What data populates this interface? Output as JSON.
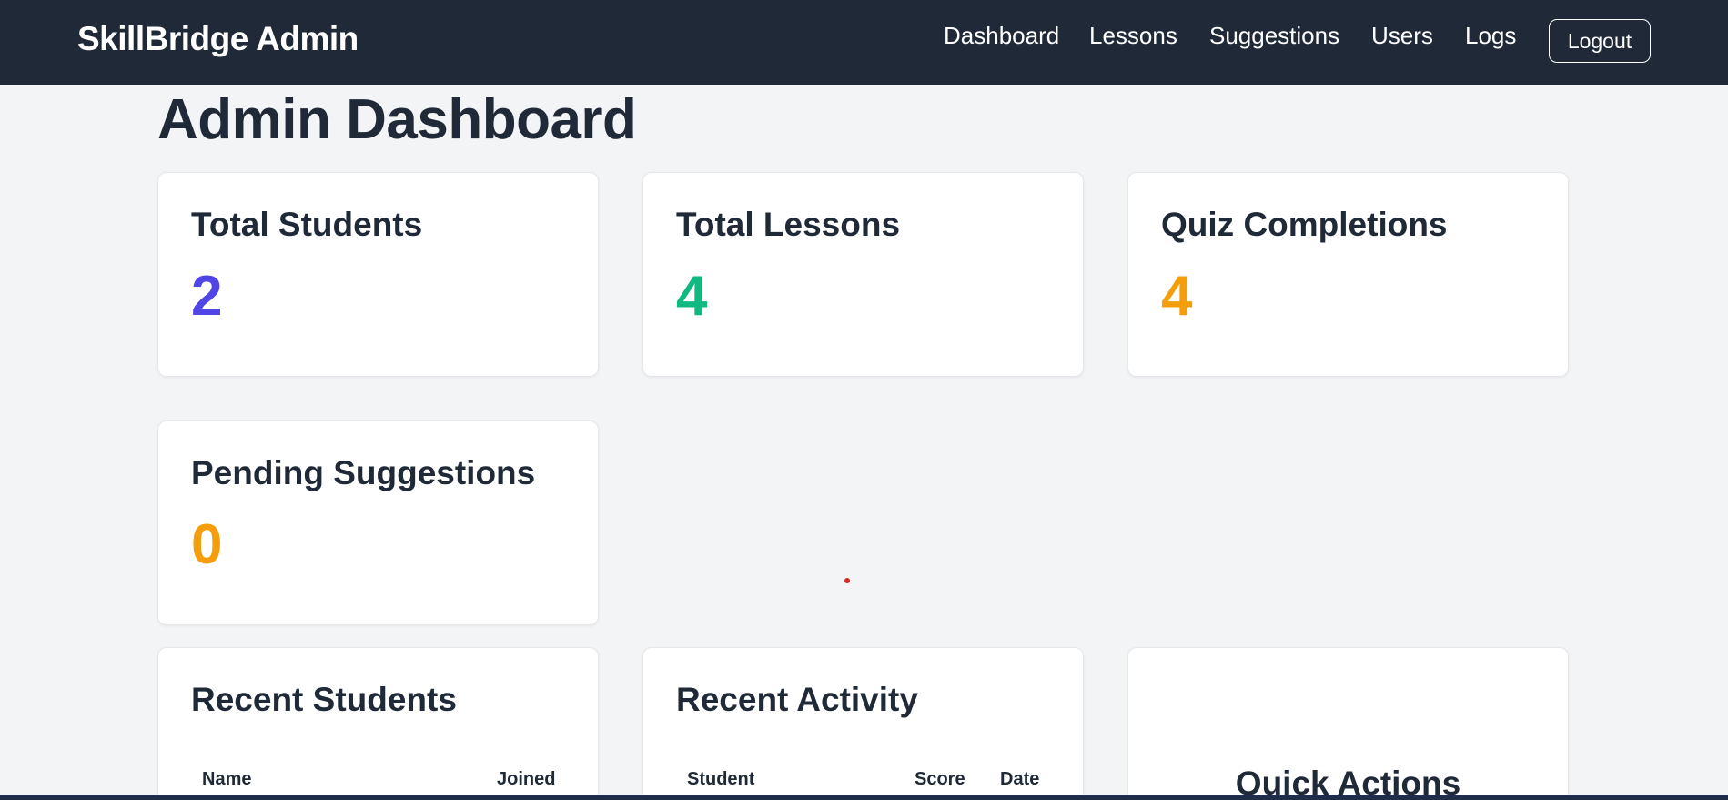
{
  "header": {
    "brand": "SkillBridge Admin",
    "nav": [
      "Dashboard",
      "Lessons",
      "Suggestions",
      "Users",
      "Logs"
    ],
    "logout_label": "Logout"
  },
  "main": {
    "title": "Admin Dashboard",
    "stats": [
      {
        "label": "Total Students",
        "value": "2",
        "color": "#4f46e5"
      },
      {
        "label": "Total Lessons",
        "value": "4",
        "color": "#10b981"
      },
      {
        "label": "Quiz Completions",
        "value": "4",
        "color": "#f59e0b"
      },
      {
        "label": "Pending Suggestions",
        "value": "0",
        "color": "#f59e0b"
      }
    ],
    "recent_students": {
      "title": "Recent Students",
      "columns": [
        "Name",
        "Joined"
      ]
    },
    "recent_activity": {
      "title": "Recent Activity",
      "columns": [
        "Student",
        "Score",
        "Date"
      ]
    },
    "quick_actions": {
      "title": "Quick Actions"
    }
  },
  "colors": {
    "navbar": "#1f2937",
    "background": "#f3f4f6",
    "accent_indigo": "#4f46e5",
    "accent_green": "#10b981",
    "accent_amber": "#f59e0b"
  }
}
